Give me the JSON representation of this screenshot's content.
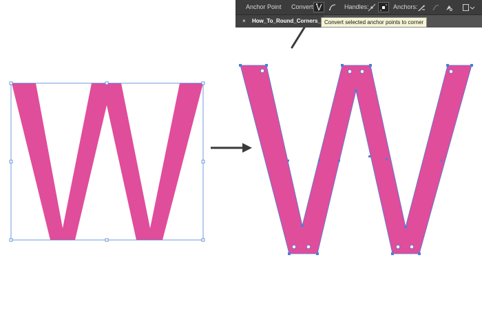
{
  "toolbar": {
    "anchor_point_label": "Anchor Point",
    "convert_label": "Convert:",
    "handles_label": "Handles:",
    "anchors_label": "Anchors:",
    "convert_corner_icon": "convert-to-corner-icon",
    "convert_smooth_icon": "convert-to-smooth-icon",
    "show_handles_icon": "show-handles-icon",
    "hide_handles_icon": "hide-handles-icon",
    "remove_anchor_icon": "remove-anchor-icon",
    "connect_path_icon": "connect-path-icon",
    "cut_path_icon": "cut-path-icon",
    "transform_icon": "transform-icon"
  },
  "document_tab": {
    "close_symbol": "×",
    "name": "How_To_Round_Corners_Illus"
  },
  "tooltip": {
    "text": "Convert selected anchor points to corner"
  },
  "colors": {
    "letter_fill": "#e04d9b",
    "selection_blue": "#4c7fd6",
    "toolbar_bg": "#3c3c3c",
    "arrow_gray": "#3a3a3a"
  }
}
